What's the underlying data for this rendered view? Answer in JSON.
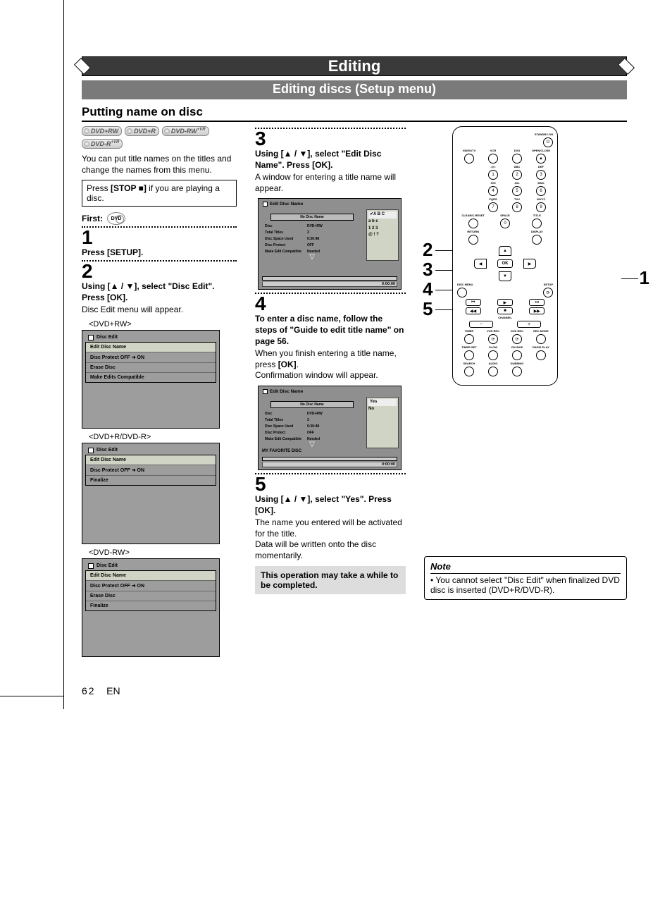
{
  "banner": {
    "title": "Editing",
    "subtitle": "Editing discs (Setup menu)"
  },
  "section": {
    "heading": "Putting name on disc"
  },
  "disc_badges": [
    "DVD+RW",
    "DVD+R",
    "DVD-RW",
    "DVD-R"
  ],
  "badge_sup": "+VR",
  "intro": "You can put title names on the titles and change the names from this menu.",
  "stop_box_pre": "Press ",
  "stop_box_bold": "[STOP ■]",
  "stop_box_post": " if you are playing a disc.",
  "first_label": "First:",
  "first_icon_text": "DVD",
  "step1": {
    "num": "1",
    "bold": "Press [SETUP]."
  },
  "step2": {
    "num": "2",
    "bold": "Using [▲ / ▼], select \"Disc Edit\". Press [OK].",
    "body": "Disc Edit menu will appear."
  },
  "screens_left": [
    {
      "label": "<DVD+RW>",
      "title": "Disc Edit",
      "items": [
        "Edit Disc Name",
        "Disc Protect OFF  ➜  ON",
        "Erase Disc",
        "Make Edits Compatible"
      ]
    },
    {
      "label": "<DVD+R/DVD-R>",
      "title": "Disc Edit",
      "items": [
        "Edit Disc Name",
        "Disc Protect OFF  ➜  ON",
        "Finalize"
      ]
    },
    {
      "label": "<DVD-RW>",
      "title": "Disc Edit",
      "items": [
        "Edit Disc Name",
        "Disc Protect OFF  ➜  ON",
        "Erase Disc",
        "Finalize"
      ]
    }
  ],
  "step3": {
    "num": "3",
    "bold": "Using [▲ / ▼], select \"Edit Disc Name\". Press [OK].",
    "body": "A window for entering a title name will appear."
  },
  "edit_screen1": {
    "title": "Edit Disc Name",
    "name_box": "No Disc Name",
    "info": [
      [
        "Disc",
        "DVD+RW"
      ],
      [
        "Total Titles",
        "3"
      ],
      [
        "Disc Space Used",
        "0:30:48"
      ],
      [
        "Disc Protect",
        "OFF"
      ],
      [
        "Make Edit Compatible",
        "Needed"
      ]
    ],
    "keypad": [
      "✔A  B  C",
      "a  b  c",
      "1  2  3",
      "@  !  ?"
    ],
    "time": "0:00:00"
  },
  "step4": {
    "num": "4",
    "bold": "To enter a disc name, follow the steps of \"Guide to edit title name\" on page 56.",
    "body1": "When you finish entering a title name, press ",
    "body1_bold": "[OK]",
    "body1_post": ".",
    "body2": "Confirmation window will appear."
  },
  "edit_screen2": {
    "title": "Edit Disc Name",
    "name_box": "No Disc Name",
    "info": [
      [
        "Disc",
        "DVD+RW"
      ],
      [
        "Total Titles",
        "3"
      ],
      [
        "Disc Space Used",
        "0:30:48"
      ],
      [
        "Disc Protect",
        "OFF"
      ],
      [
        "Make Edit Compatible",
        "Needed"
      ]
    ],
    "options": [
      "Yes",
      "No"
    ],
    "fav": "MY FAVORITE DISC",
    "time": "0:00:00"
  },
  "step5": {
    "num": "5",
    "bold": "Using [▲ / ▼], select \"Yes\". Press [OK].",
    "body": "The name you entered will be activated for the title.\nData will be written onto the disc momentarily."
  },
  "gray_note": "This operation may take a while to be completed.",
  "remote": {
    "top": "STANDBY-ON",
    "row1_labels": [
      "VIDEO/TV",
      "VCR",
      "DVD",
      "OPEN/CLOSE"
    ],
    "row2_labels": [
      ".@/:",
      "ABC",
      "DEF"
    ],
    "row3_labels": [
      "GHI",
      "JKL",
      "MNO"
    ],
    "row4_labels": [
      "PQRS",
      "TUV",
      "WXYZ"
    ],
    "nums1": [
      "1",
      "2",
      "3"
    ],
    "nums2": [
      "4",
      "5",
      "6"
    ],
    "nums3": [
      "7",
      "8",
      "9"
    ],
    "row5_labels": [
      "CLEAR/C-RESET",
      "SPACE",
      "TITLE"
    ],
    "zero": "0",
    "row6_labels": [
      "RETURN",
      "",
      "DISPLAY"
    ],
    "ok": "OK",
    "side_left": "DISC MENU",
    "side_right": "SETUP",
    "transport": [
      "⏮",
      "▶",
      "⏭"
    ],
    "transport2": [
      "◀◀",
      "■",
      "▶▶"
    ],
    "channel": "CHANNEL",
    "ch_btns": [
      "−",
      "+"
    ],
    "rec_row_labels": [
      "TIMER",
      "VCR REC",
      "DVD REC",
      "REC MODE"
    ],
    "bot_row_labels": [
      "TIMER SET",
      "SLOW",
      "CM SKIP",
      "RAPID PLAY"
    ],
    "bot2_labels": [
      "SEARCH",
      "AUDIO",
      "DUBBING"
    ]
  },
  "callouts": {
    "left": [
      "2",
      "3",
      "4",
      "5"
    ],
    "right": "1"
  },
  "note": {
    "title": "Note",
    "text": "You cannot select \"Disc Edit\" when finalized DVD disc is inserted (DVD+R/DVD-R)."
  },
  "footer": {
    "page": "62",
    "lang": "EN"
  }
}
